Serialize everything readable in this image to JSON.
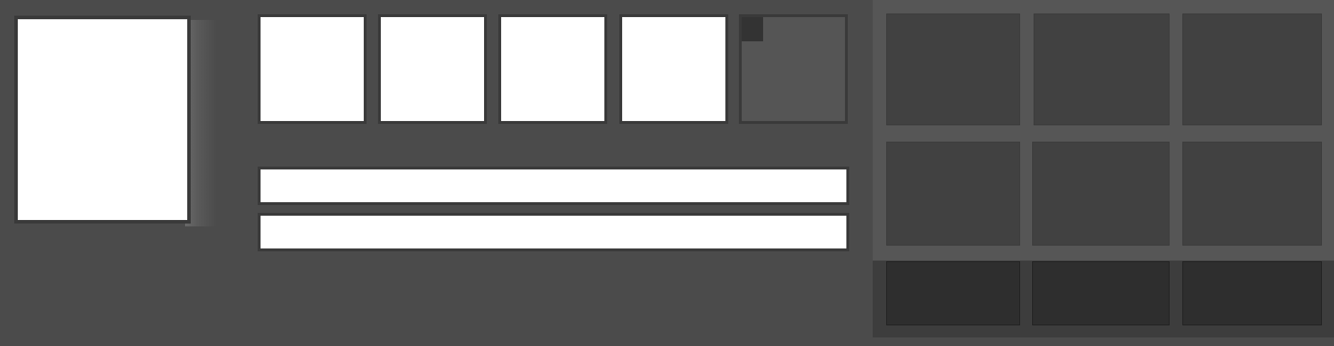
{
  "colors": {
    "background": "#4b4b4b",
    "panel": "#565656",
    "cell": "#414141",
    "cell_dark": "#2e2e2e",
    "border": "#3a3a3a",
    "field": "#ffffff"
  },
  "preview": {
    "kind": "blank-white"
  },
  "swatches": [
    {
      "state": "white"
    },
    {
      "state": "white"
    },
    {
      "state": "white"
    },
    {
      "state": "white"
    },
    {
      "state": "empty"
    }
  ],
  "fields": [
    {
      "value": ""
    },
    {
      "value": ""
    }
  ],
  "grid": {
    "rows": 3,
    "columns": 3
  }
}
